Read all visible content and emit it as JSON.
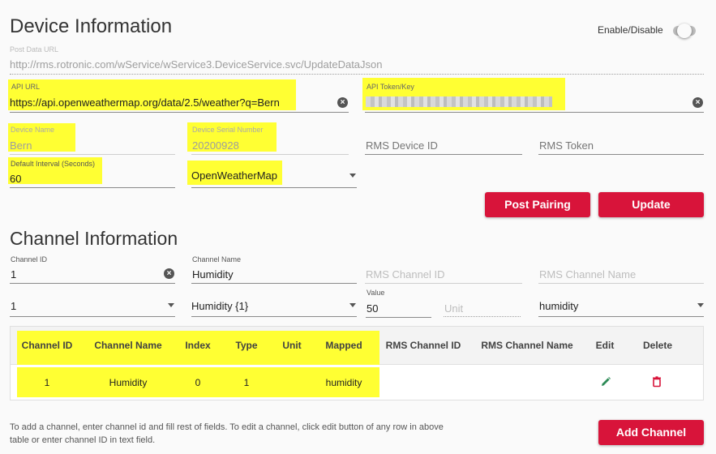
{
  "device": {
    "title": "Device Information",
    "toggle_label": "Enable/Disable",
    "post_url_label": "Post Data URL",
    "post_url_value": "http://rms.rotronic.com/wService/wService3.DeviceService.svc/UpdateDataJson",
    "api_url_label": "API URL",
    "api_url_value": "https://api.openweathermap.org/data/2.5/weather?q=Bern",
    "api_token_label": "API Token/Key",
    "device_name_label": "Device Name",
    "device_name_value": "Bern",
    "serial_label": "Device Serial Number",
    "serial_value": "20200928",
    "rms_device_id_placeholder": "RMS Device ID",
    "rms_token_placeholder": "RMS Token",
    "interval_label": "Default Interval (Seconds)",
    "interval_value": "60",
    "source_value": "OpenWeatherMap",
    "post_pairing_label": "Post Pairing",
    "update_label": "Update"
  },
  "channel": {
    "title": "Channel Information",
    "id_label": "Channel ID",
    "id_value": "1",
    "name_label": "Channel Name",
    "name_value": "Humidity",
    "rms_id_placeholder": "RMS Channel ID",
    "rms_name_placeholder": "RMS Channel Name",
    "index_value": "1",
    "type_value": "Humidity {1}",
    "value_label": "Value",
    "value_value": "50",
    "unit_placeholder": "Unit",
    "mapped_value": "humidity"
  },
  "table": {
    "headers": [
      "Channel ID",
      "Channel Name",
      "Index",
      "Type",
      "Unit",
      "Mapped",
      "RMS Channel ID",
      "RMS Channel Name",
      "Edit",
      "Delete"
    ],
    "rows": [
      [
        "1",
        "Humidity",
        "0",
        "1",
        "",
        "humidity",
        "",
        ""
      ]
    ]
  },
  "footer": {
    "help_text": "To add a channel, enter channel id and fill rest of fields. To edit a channel, click edit button of any row in above table or enter channel ID in text field.",
    "add_channel_label": "Add Channel"
  },
  "colors": {
    "accent": "#d8143a",
    "highlight": "#ffff33",
    "edit": "#2e8b57",
    "delete": "#d8143a"
  }
}
